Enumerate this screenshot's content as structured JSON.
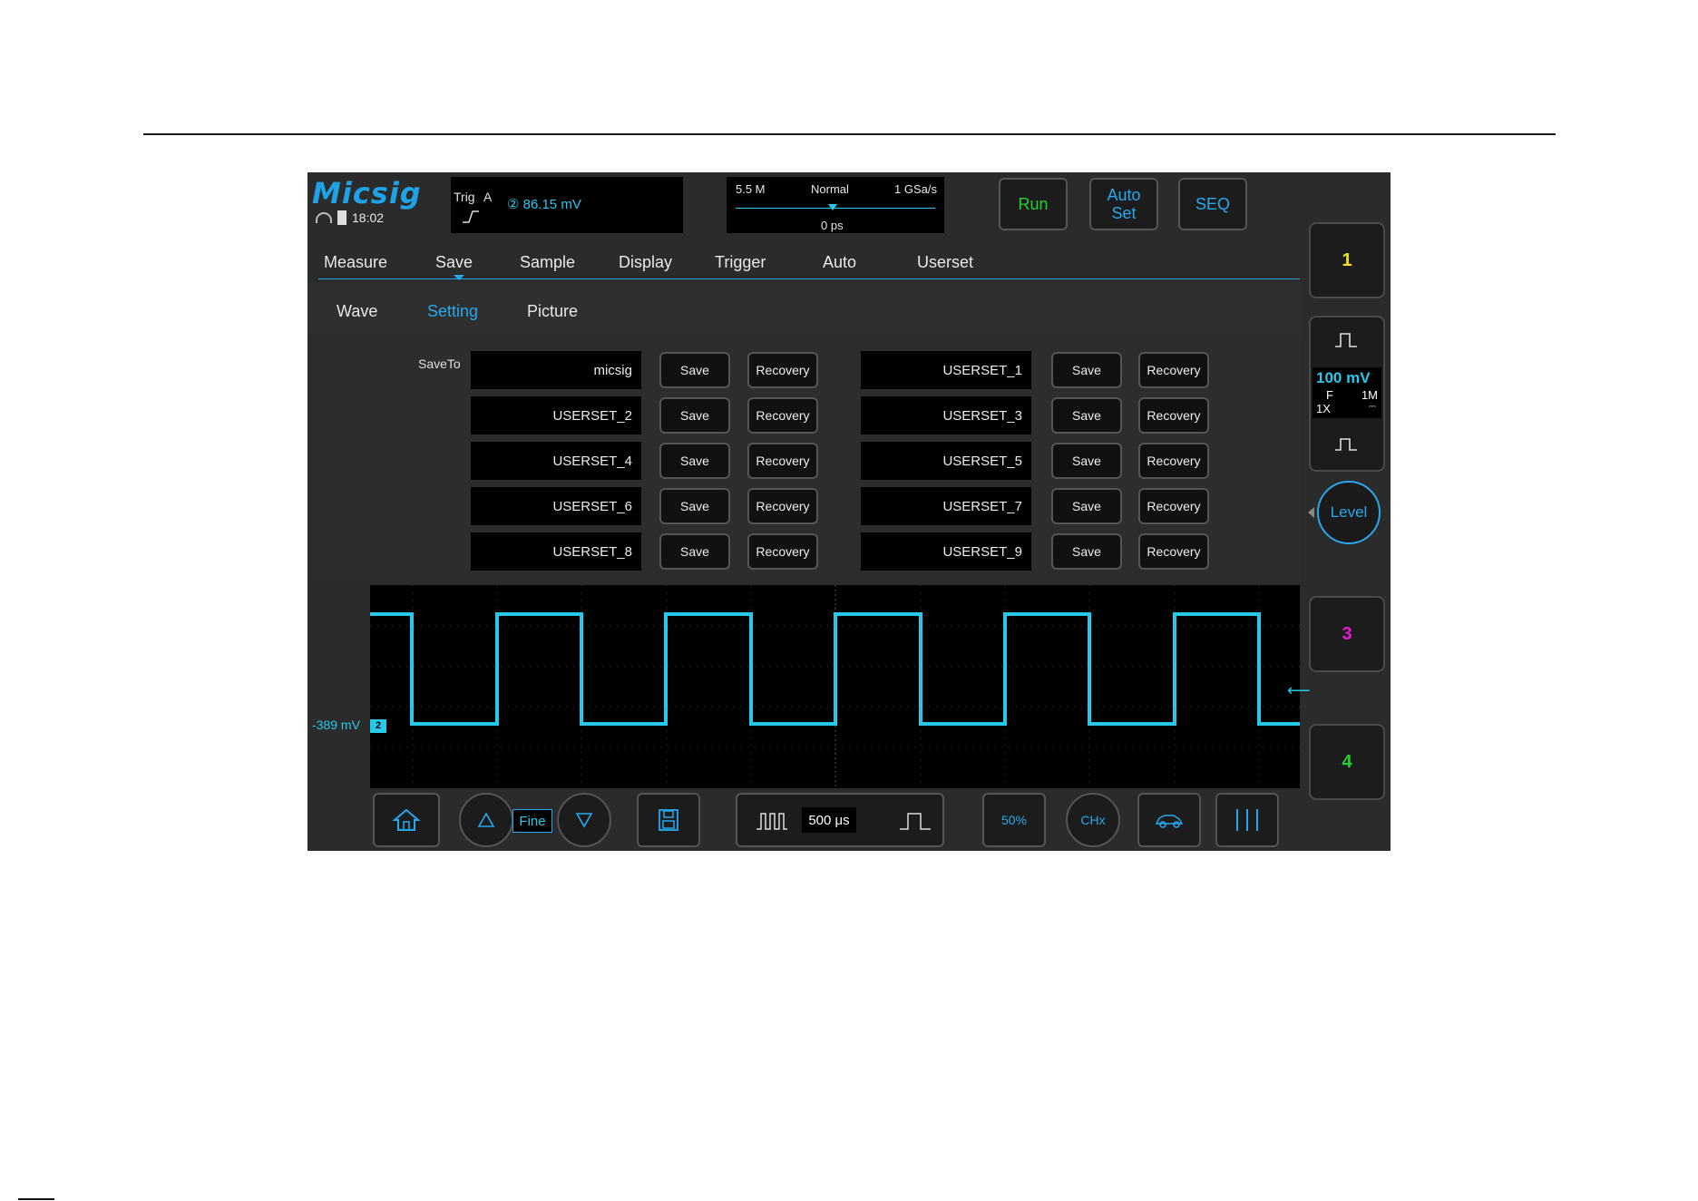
{
  "brand": "Micsig",
  "status": {
    "time": "18:02"
  },
  "trigger": {
    "label": "Trig",
    "source": "A",
    "value": "② 86.15  mV"
  },
  "timebase": {
    "memory": "5.5 M",
    "mode": "Normal",
    "sample_rate": "1 GSa/s",
    "delay": "0 ps"
  },
  "top_buttons": {
    "run": "Run",
    "auto_line1": "Auto",
    "auto_line2": "Set",
    "seq": "SEQ"
  },
  "channels": {
    "ch1": "1",
    "ch3": "3",
    "ch4": "4",
    "ch2": {
      "volts": "100 mV",
      "coupling": "F",
      "impedance": "1M",
      "probe": "1X"
    },
    "colors": {
      "ch1": "#f2e21b",
      "ch2": "#27c9ea",
      "ch3": "#e11ccf",
      "ch4": "#25d12e"
    }
  },
  "level_label": "Level",
  "menu_tabs": [
    "Measure",
    "Save",
    "Sample",
    "Display",
    "Trigger",
    "Auto",
    "Userset"
  ],
  "sub_tabs": [
    "Wave",
    "Setting",
    "Picture"
  ],
  "save_panel": {
    "save_to_label": "SaveTo",
    "save_label": "Save",
    "recovery_label": "Recovery",
    "slots_left": [
      "micsig",
      "USERSET_2",
      "USERSET_4",
      "USERSET_6",
      "USERSET_8"
    ],
    "slots_right": [
      "USERSET_1",
      "USERSET_3",
      "USERSET_5",
      "USERSET_7",
      "USERSET_9"
    ]
  },
  "waveform": {
    "offset_label": "-389 mV",
    "channel_tag": "2"
  },
  "toolbar": {
    "fine_label": "Fine",
    "timebase": "500 μs",
    "fifty_percent": "50%",
    "chx": "CHx"
  }
}
